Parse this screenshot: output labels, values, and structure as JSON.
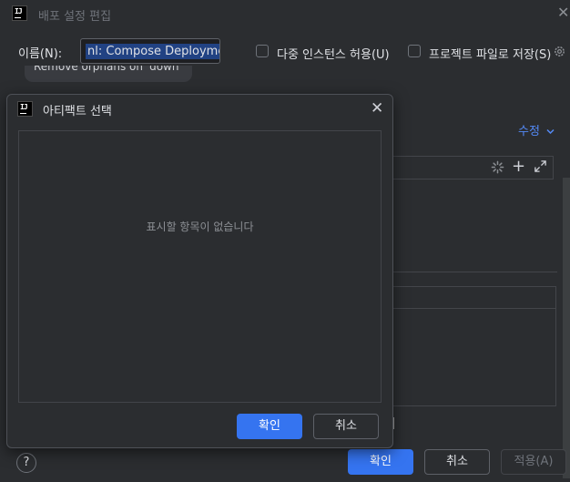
{
  "background_dialog": {
    "title": "배포 설정 편집",
    "name_label": "이름(N):",
    "name_value": "nl: Compose Deployment",
    "allow_multiple_label": "다중 인스턴스 허용(U)",
    "store_project_label": "프로젝트 파일로 저장(S)",
    "tag_text": "Remove orphans on 'down'",
    "modify_label": "수정",
    "ok_label": "확인",
    "cancel_label": "취소",
    "apply_label": "적용(A)",
    "help_label": "?"
  },
  "modal": {
    "title": "아티팩트 선택",
    "empty_text": "표시할 항목이 없습니다",
    "ok_label": "확인",
    "cancel_label": "취소"
  },
  "icons": {
    "app": "intellij-logo-icon",
    "close": "close-icon",
    "gear": "gear-icon",
    "chevron": "chevron-down-icon",
    "spinner": "spinner-icon",
    "plus": "plus-icon",
    "expand": "expand-icon"
  },
  "colors": {
    "accent": "#3574f0",
    "link": "#548af7",
    "background": "#2b2d30",
    "selection": "#214283"
  }
}
